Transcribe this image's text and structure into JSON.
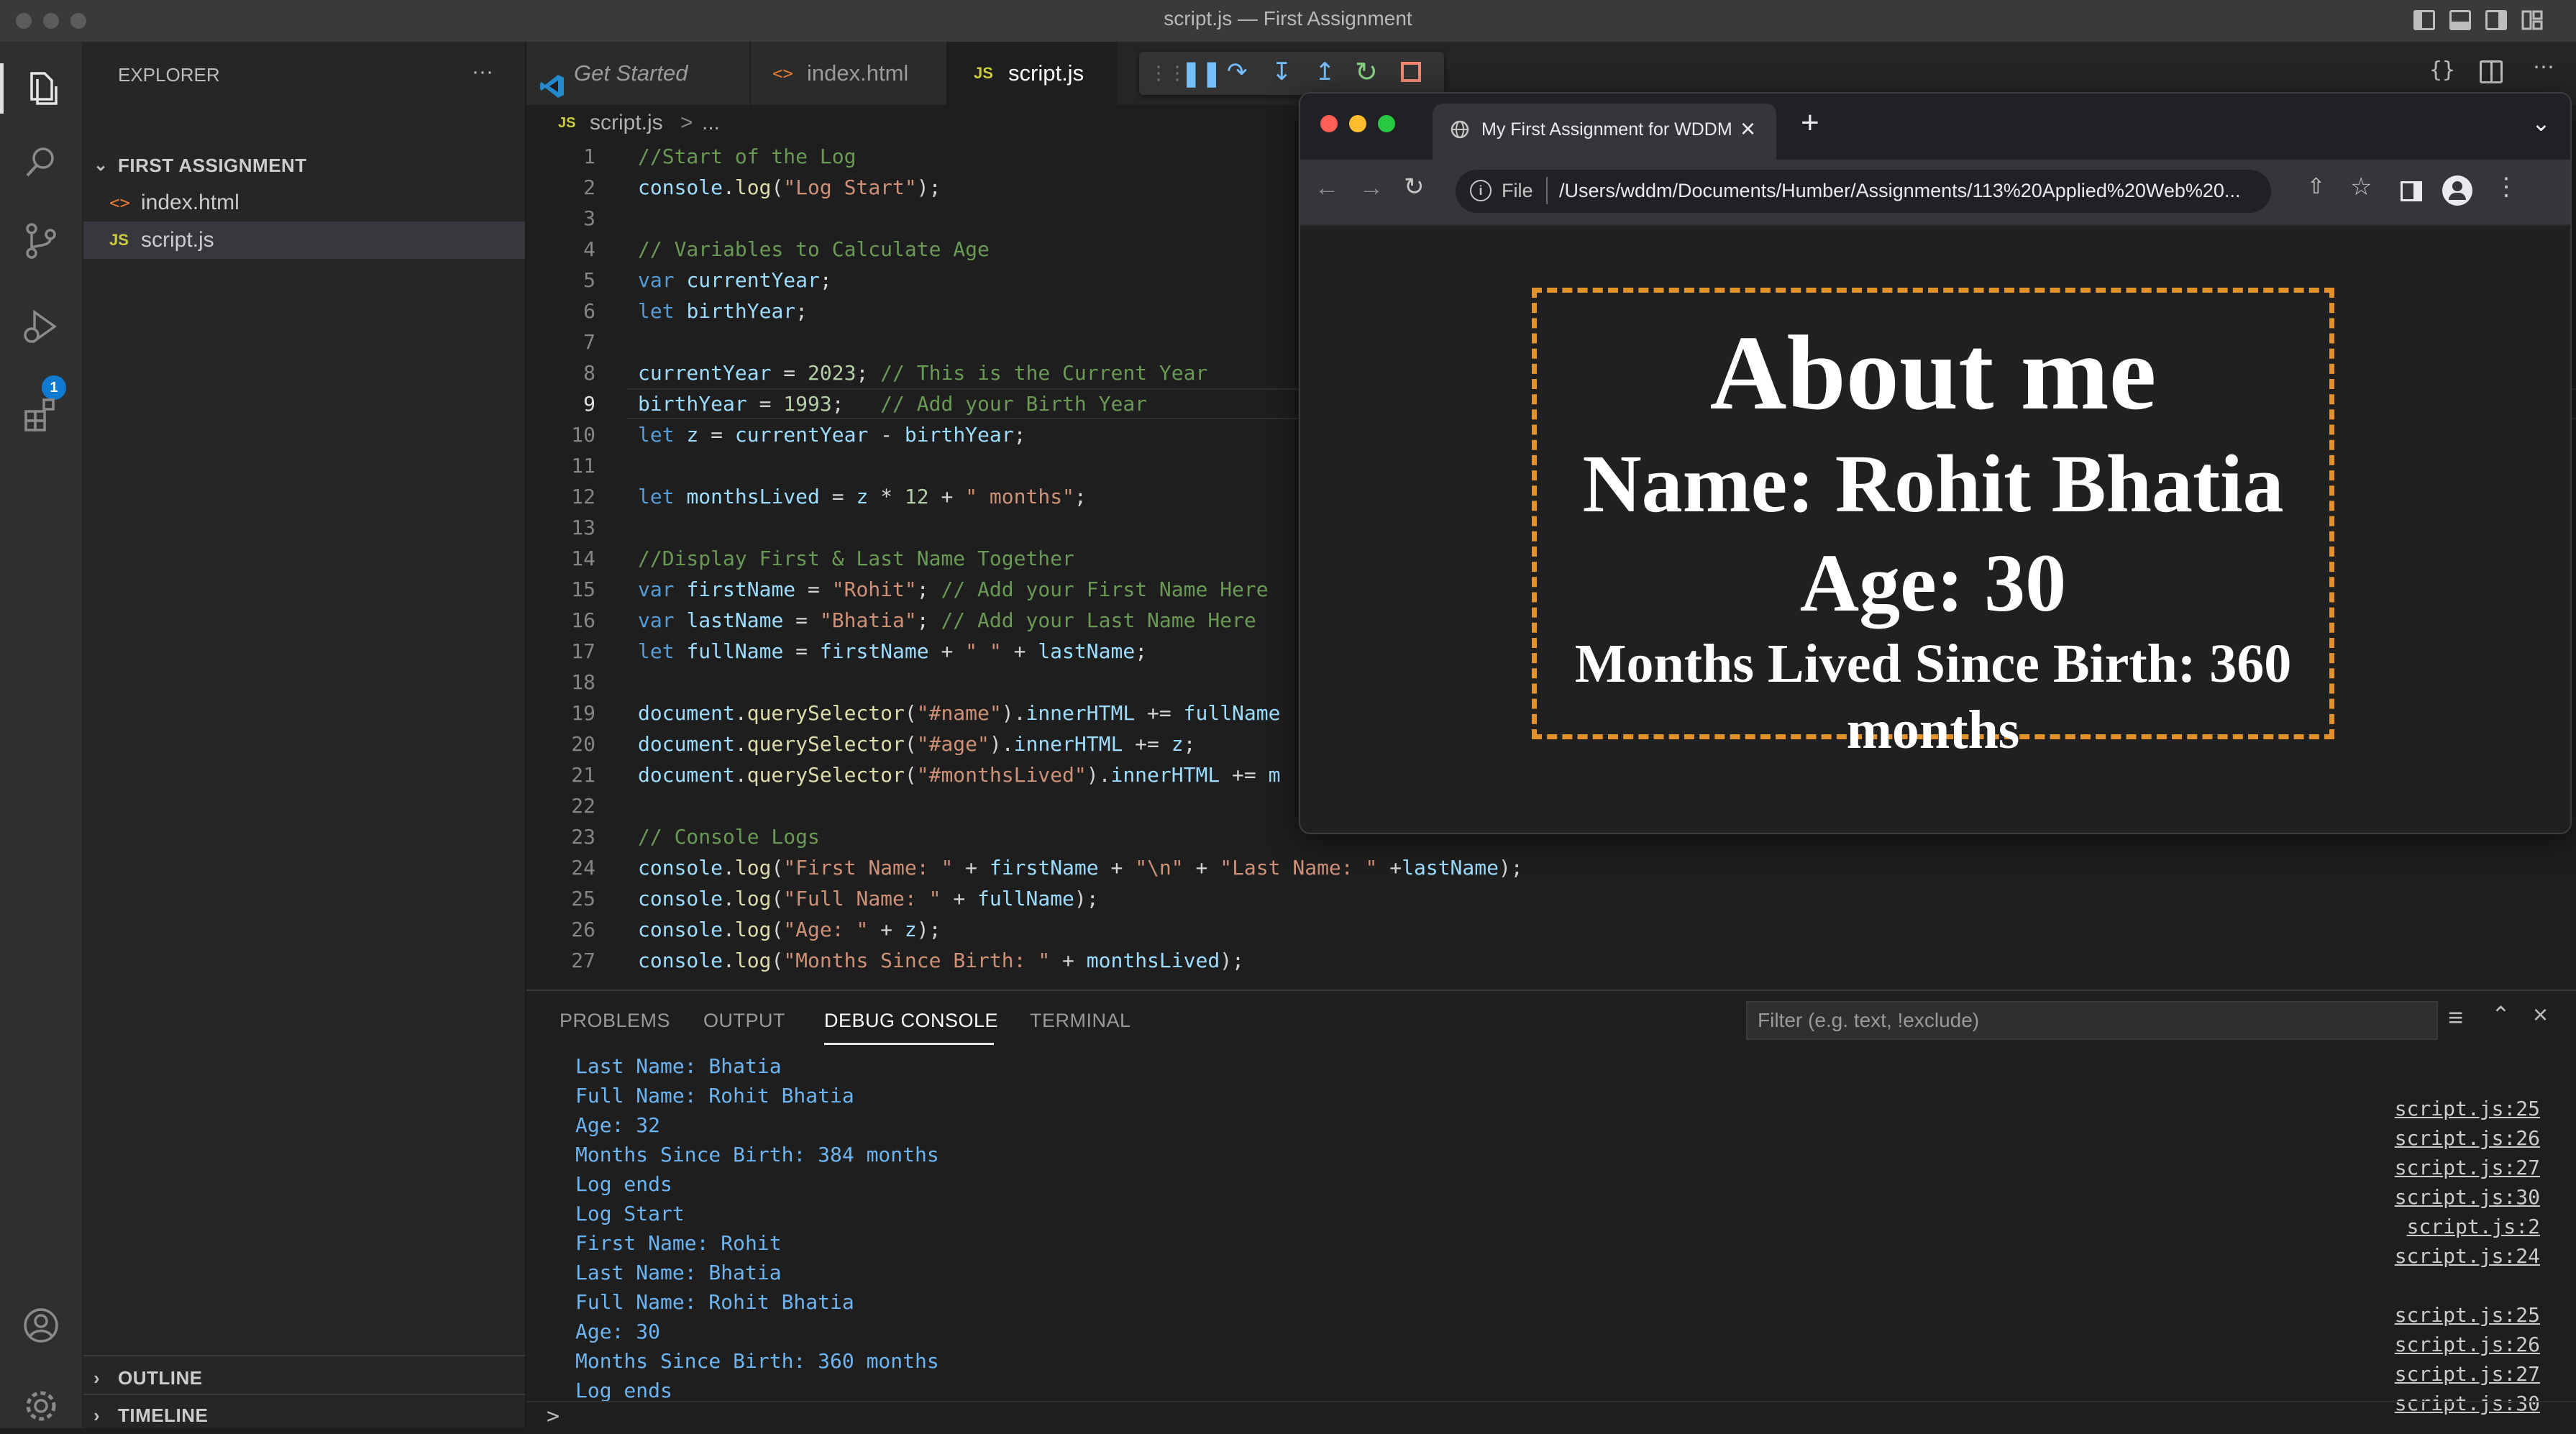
{
  "window": {
    "title": "script.js — First Assignment"
  },
  "sidebar": {
    "title": "EXPLORER",
    "more": "···",
    "folder": "FIRST ASSIGNMENT",
    "files": [
      {
        "icon": "<>",
        "name": "index.html"
      },
      {
        "icon": "JS",
        "name": "script.js"
      }
    ],
    "outline": "OUTLINE",
    "timeline": "TIMELINE"
  },
  "activity": {
    "debug_badge": "1"
  },
  "tabs": [
    {
      "icon": "vscode-icon",
      "label": "Get Started"
    },
    {
      "icon": "<>",
      "label": "index.html"
    },
    {
      "icon": "JS",
      "label": "script.js"
    }
  ],
  "breadcrumb": {
    "icon": "JS",
    "file": "script.js",
    "sep": ">",
    "rest": "..."
  },
  "editor": {
    "lines": [
      {
        "n": "1",
        "tokens": [
          [
            "cm",
            "//Start of the Log"
          ]
        ]
      },
      {
        "n": "2",
        "tokens": [
          [
            "var",
            "console"
          ],
          [
            "plain",
            "."
          ],
          [
            "fn",
            "log"
          ],
          [
            "plain",
            "("
          ],
          [
            "str",
            "\"Log Start\""
          ],
          [
            "plain",
            ");"
          ]
        ]
      },
      {
        "n": "3",
        "tokens": []
      },
      {
        "n": "4",
        "tokens": [
          [
            "cm",
            "// Variables to Calculate Age"
          ]
        ]
      },
      {
        "n": "5",
        "tokens": [
          [
            "kw",
            "var "
          ],
          [
            "var",
            "currentYear"
          ],
          [
            "plain",
            ";"
          ]
        ]
      },
      {
        "n": "6",
        "tokens": [
          [
            "kw",
            "let "
          ],
          [
            "var",
            "birthYear"
          ],
          [
            "plain",
            ";"
          ]
        ]
      },
      {
        "n": "7",
        "tokens": []
      },
      {
        "n": "8",
        "tokens": [
          [
            "var",
            "currentYear"
          ],
          [
            "plain",
            " = "
          ],
          [
            "num",
            "2023"
          ],
          [
            "plain",
            "; "
          ],
          [
            "cm",
            "// This is the Current Year"
          ]
        ]
      },
      {
        "n": "9",
        "tokens": [
          [
            "var",
            "birthYear"
          ],
          [
            "plain",
            " = "
          ],
          [
            "num",
            "1993"
          ],
          [
            "plain",
            ";   "
          ],
          [
            "cm",
            "// Add your Birth Year"
          ]
        ]
      },
      {
        "n": "10",
        "tokens": [
          [
            "kw",
            "let "
          ],
          [
            "var",
            "z"
          ],
          [
            "plain",
            " = "
          ],
          [
            "var",
            "currentYear"
          ],
          [
            "plain",
            " - "
          ],
          [
            "var",
            "birthYear"
          ],
          [
            "plain",
            ";"
          ]
        ]
      },
      {
        "n": "11",
        "tokens": []
      },
      {
        "n": "12",
        "tokens": [
          [
            "kw",
            "let "
          ],
          [
            "var",
            "monthsLived"
          ],
          [
            "plain",
            " = "
          ],
          [
            "var",
            "z"
          ],
          [
            "plain",
            " * "
          ],
          [
            "num",
            "12"
          ],
          [
            "plain",
            " + "
          ],
          [
            "str",
            "\" months\""
          ],
          [
            "plain",
            ";"
          ]
        ]
      },
      {
        "n": "13",
        "tokens": []
      },
      {
        "n": "14",
        "tokens": [
          [
            "cm",
            "//Display First & Last Name Together"
          ]
        ]
      },
      {
        "n": "15",
        "tokens": [
          [
            "kw",
            "var "
          ],
          [
            "var",
            "firstName"
          ],
          [
            "plain",
            " = "
          ],
          [
            "str",
            "\"Rohit\""
          ],
          [
            "plain",
            "; "
          ],
          [
            "cm",
            "// Add your First Name Here"
          ]
        ]
      },
      {
        "n": "16",
        "tokens": [
          [
            "kw",
            "var "
          ],
          [
            "var",
            "lastName"
          ],
          [
            "plain",
            " = "
          ],
          [
            "str",
            "\"Bhatia\""
          ],
          [
            "plain",
            "; "
          ],
          [
            "cm",
            "// Add your Last Name Here"
          ]
        ]
      },
      {
        "n": "17",
        "tokens": [
          [
            "kw",
            "let "
          ],
          [
            "var",
            "fullName"
          ],
          [
            "plain",
            " = "
          ],
          [
            "var",
            "firstName"
          ],
          [
            "plain",
            " + "
          ],
          [
            "str",
            "\" \""
          ],
          [
            "plain",
            " + "
          ],
          [
            "var",
            "lastName"
          ],
          [
            "plain",
            ";"
          ]
        ]
      },
      {
        "n": "18",
        "tokens": []
      },
      {
        "n": "19",
        "tokens": [
          [
            "var",
            "document"
          ],
          [
            "plain",
            "."
          ],
          [
            "fn",
            "querySelector"
          ],
          [
            "plain",
            "("
          ],
          [
            "str",
            "\"#name\""
          ],
          [
            "plain",
            ")."
          ],
          [
            "var",
            "innerHTML"
          ],
          [
            "plain",
            " += "
          ],
          [
            "var",
            "fullName"
          ]
        ]
      },
      {
        "n": "20",
        "tokens": [
          [
            "var",
            "document"
          ],
          [
            "plain",
            "."
          ],
          [
            "fn",
            "querySelector"
          ],
          [
            "plain",
            "("
          ],
          [
            "str",
            "\"#age\""
          ],
          [
            "plain",
            ")."
          ],
          [
            "var",
            "innerHTML"
          ],
          [
            "plain",
            " += "
          ],
          [
            "var",
            "z"
          ],
          [
            "plain",
            ";"
          ]
        ]
      },
      {
        "n": "21",
        "tokens": [
          [
            "var",
            "document"
          ],
          [
            "plain",
            "."
          ],
          [
            "fn",
            "querySelector"
          ],
          [
            "plain",
            "("
          ],
          [
            "str",
            "\"#monthsLived\""
          ],
          [
            "plain",
            ")."
          ],
          [
            "var",
            "innerHTML"
          ],
          [
            "plain",
            " += "
          ],
          [
            "var",
            "m"
          ]
        ]
      },
      {
        "n": "22",
        "tokens": []
      },
      {
        "n": "23",
        "tokens": [
          [
            "cm",
            "// Console Logs"
          ]
        ]
      },
      {
        "n": "24",
        "tokens": [
          [
            "var",
            "console"
          ],
          [
            "plain",
            "."
          ],
          [
            "fn",
            "log"
          ],
          [
            "plain",
            "("
          ],
          [
            "str",
            "\"First Name: \""
          ],
          [
            "plain",
            " + "
          ],
          [
            "var",
            "firstName"
          ],
          [
            "plain",
            " + "
          ],
          [
            "str",
            "\"\\n\""
          ],
          [
            "plain",
            " + "
          ],
          [
            "str",
            "\"Last Name: \""
          ],
          [
            "plain",
            " +"
          ],
          [
            "var",
            "lastName"
          ],
          [
            "plain",
            ");"
          ]
        ]
      },
      {
        "n": "25",
        "tokens": [
          [
            "var",
            "console"
          ],
          [
            "plain",
            "."
          ],
          [
            "fn",
            "log"
          ],
          [
            "plain",
            "("
          ],
          [
            "str",
            "\"Full Name: \""
          ],
          [
            "plain",
            " + "
          ],
          [
            "var",
            "fullName"
          ],
          [
            "plain",
            ");"
          ]
        ]
      },
      {
        "n": "26",
        "tokens": [
          [
            "var",
            "console"
          ],
          [
            "plain",
            "."
          ],
          [
            "fn",
            "log"
          ],
          [
            "plain",
            "("
          ],
          [
            "str",
            "\"Age: \""
          ],
          [
            "plain",
            " + "
          ],
          [
            "var",
            "z"
          ],
          [
            "plain",
            ");"
          ]
        ]
      },
      {
        "n": "27",
        "tokens": [
          [
            "var",
            "console"
          ],
          [
            "plain",
            "."
          ],
          [
            "fn",
            "log"
          ],
          [
            "plain",
            "("
          ],
          [
            "str",
            "\"Months Since Birth: \""
          ],
          [
            "plain",
            " + "
          ],
          [
            "var",
            "monthsLived"
          ],
          [
            "plain",
            ");"
          ]
        ]
      }
    ]
  },
  "panel": {
    "tabs": [
      "PROBLEMS",
      "OUTPUT",
      "DEBUG CONSOLE",
      "TERMINAL"
    ],
    "filter_placeholder": "Filter (e.g. text, !exclude)",
    "console": [
      {
        "text": "Last Name: Bhatia",
        "src": ""
      },
      {
        "text": "Full Name: Rohit Bhatia",
        "src": "script.js:25"
      },
      {
        "text": "Age: 32",
        "src": "script.js:26"
      },
      {
        "text": "Months Since Birth: 384 months",
        "src": "script.js:27"
      },
      {
        "text": "Log ends",
        "src": "script.js:30"
      },
      {
        "text": "Log Start",
        "src": "script.js:2"
      },
      {
        "text": "First Name: Rohit",
        "src": "script.js:24"
      },
      {
        "text": "Last Name: Bhatia",
        "src": ""
      },
      {
        "text": "Full Name: Rohit Bhatia",
        "src": "script.js:25"
      },
      {
        "text": "Age: 30",
        "src": "script.js:26"
      },
      {
        "text": "Months Since Birth: 360 months",
        "src": "script.js:27"
      },
      {
        "text": "Log ends",
        "src": "script.js:30"
      }
    ],
    "prompt": ">"
  },
  "browser": {
    "tab_title": "My First Assignment for WDDM",
    "close": "×",
    "new_tab": "+",
    "file_label": "File",
    "url": "/Users/wddm/Documents/Humber/Assignments/113%20Applied%20Web%20...",
    "page": {
      "heading": "About me",
      "name": "Name: Rohit Bhatia",
      "age": "Age: 30",
      "months": "Months Lived Since Birth: 360 months"
    }
  },
  "colors": {
    "accent": "#0e7ad1",
    "dashed_border": "#e2912b",
    "console_text": "#6cb4f2"
  }
}
